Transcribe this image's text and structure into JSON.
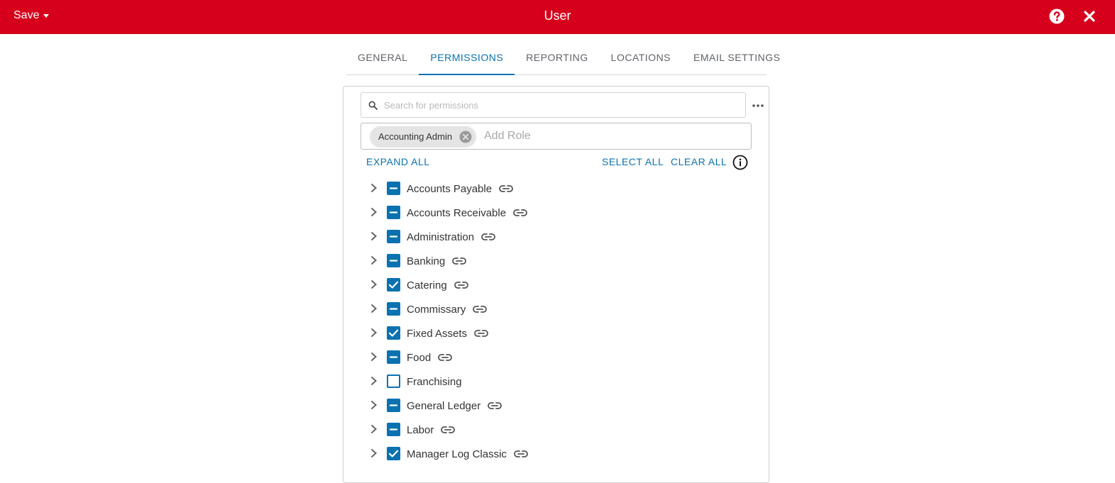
{
  "header": {
    "save_label": "Save",
    "title": "User",
    "bg_color": "#d6001c",
    "help_icon": "question-circle-icon",
    "close_icon": "close-icon"
  },
  "tabs": [
    {
      "label": "GENERAL",
      "active": false
    },
    {
      "label": "PERMISSIONS",
      "active": true
    },
    {
      "label": "REPORTING",
      "active": false
    },
    {
      "label": "LOCATIONS",
      "active": false
    },
    {
      "label": "EMAIL SETTINGS",
      "active": false
    }
  ],
  "accent_color": "#0a72b0",
  "search": {
    "placeholder": "Search for permissions",
    "value": ""
  },
  "roles": {
    "chips": [
      {
        "label": "Accounting Admin"
      }
    ],
    "placeholder": "Add Role"
  },
  "actions": {
    "expand_all": "EXPAND ALL",
    "select_all": "SELECT ALL",
    "clear_all": "CLEAR ALL"
  },
  "permissions": [
    {
      "label": "Accounts Payable",
      "state": "indeterminate",
      "linked": true
    },
    {
      "label": "Accounts Receivable",
      "state": "indeterminate",
      "linked": true
    },
    {
      "label": "Administration",
      "state": "indeterminate",
      "linked": true
    },
    {
      "label": "Banking",
      "state": "indeterminate",
      "linked": true
    },
    {
      "label": "Catering",
      "state": "checked",
      "linked": true
    },
    {
      "label": "Commissary",
      "state": "indeterminate",
      "linked": true
    },
    {
      "label": "Fixed Assets",
      "state": "checked",
      "linked": true
    },
    {
      "label": "Food",
      "state": "indeterminate",
      "linked": true
    },
    {
      "label": "Franchising",
      "state": "unchecked",
      "linked": false
    },
    {
      "label": "General Ledger",
      "state": "indeterminate",
      "linked": true
    },
    {
      "label": "Labor",
      "state": "indeterminate",
      "linked": true
    },
    {
      "label": "Manager Log Classic",
      "state": "checked",
      "linked": true
    }
  ]
}
